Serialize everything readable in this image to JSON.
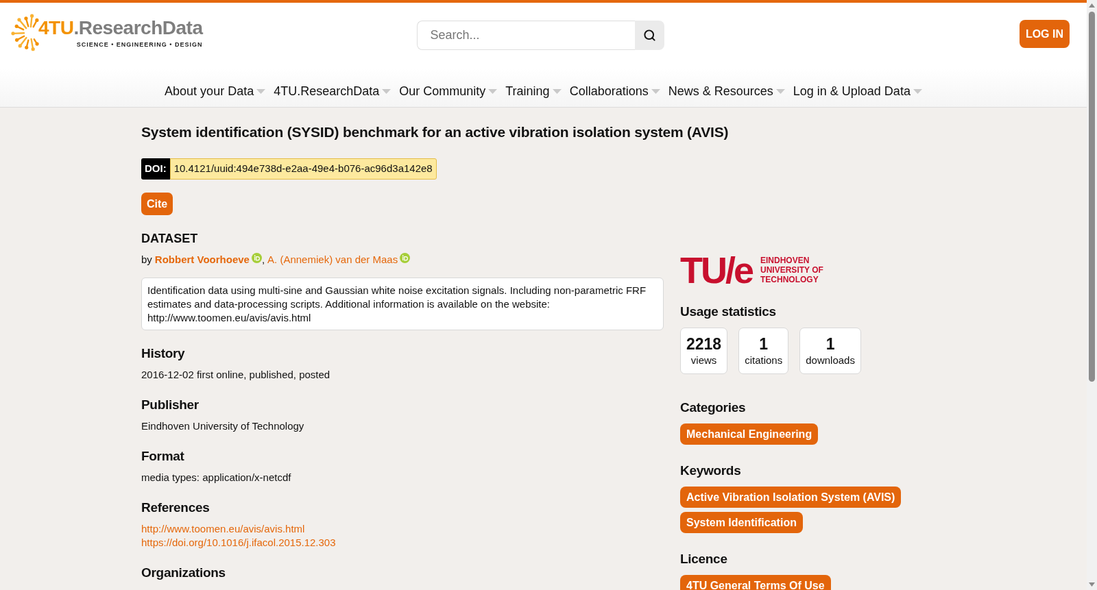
{
  "header": {
    "logo": {
      "mark": "4TU",
      "name": ".ResearchData",
      "tagline": "SCIENCE • ENGINEERING • DESIGN"
    },
    "search": {
      "placeholder": "Search..."
    },
    "login_button": "LOG IN"
  },
  "nav": [
    "About your Data",
    "4TU.ResearchData",
    "Our Community",
    "Training",
    "Collaborations",
    "News & Resources",
    "Log in & Upload Data"
  ],
  "dataset": {
    "title": "System identification (SYSID) benchmark for an active vibration isolation system (AVIS)",
    "doi": {
      "label": "DOI:",
      "value": "10.4121/uuid:494e738d-e2aa-49e4-b076-ac96d3a142e8"
    },
    "cite_button": "Cite",
    "type": "DATASET",
    "byline": {
      "prefix": "by",
      "separator": ",",
      "authors": [
        {
          "name": "Robbert Voorhoeve",
          "highlighted": true,
          "orcid": true
        },
        {
          "name": "A. (Annemiek) van der Maas",
          "highlighted": false,
          "orcid": true
        }
      ]
    },
    "description": "Identification data using multi-sine and Gaussian white noise excitation signals. Including non-parametric FRF estimates and data-processing scripts. Additional information is available on the website: http://www.toomen.eu/avis/avis.html"
  },
  "sections": [
    {
      "heading": "History",
      "lines": [
        {
          "kind": "text",
          "text": "2016-12-02 first online, published, posted"
        }
      ]
    },
    {
      "heading": "Publisher",
      "lines": [
        {
          "kind": "text",
          "text": "Eindhoven University of Technology"
        }
      ]
    },
    {
      "heading": "Format",
      "lines": [
        {
          "kind": "text",
          "text": "media types: application/x-netcdf"
        }
      ]
    },
    {
      "heading": "References",
      "lines": [
        {
          "kind": "link",
          "text": "http://www.toomen.eu/avis/avis.html"
        },
        {
          "kind": "link",
          "text": "https://doi.org/10.1016/j.ifacol.2015.12.303"
        }
      ]
    },
    {
      "heading": "Organizations"
    }
  ],
  "sidebar": {
    "institution_logo": {
      "mark": "TU/e",
      "lines": [
        "EINDHOVEN",
        "UNIVERSITY OF",
        "TECHNOLOGY"
      ]
    },
    "usage": {
      "heading": "Usage statistics",
      "stats": [
        {
          "value": "2218",
          "label": "views"
        },
        {
          "value": "1",
          "label": "citations"
        },
        {
          "value": "1",
          "label": "downloads"
        }
      ]
    },
    "categories": {
      "heading": "Categories",
      "tags": [
        "Mechanical Engineering"
      ]
    },
    "keywords": {
      "heading": "Keywords",
      "tags": [
        "Active Vibration Isolation System (AVIS)",
        "System Identification"
      ]
    },
    "licence": {
      "heading": "Licence",
      "tags": [
        "4TU General Terms Of Use"
      ]
    }
  }
}
